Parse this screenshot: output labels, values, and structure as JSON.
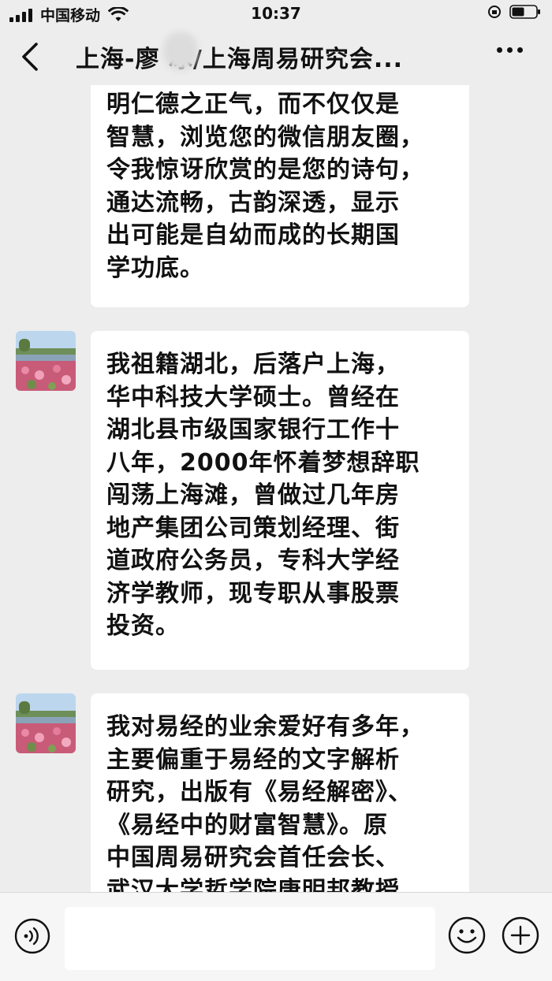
{
  "status_bar": {
    "carrier": "中国移动",
    "time": "10:37"
  },
  "header": {
    "title": "上海-廖  冰/上海周易研究会..."
  },
  "messages": [
    {
      "text": "明仁德之正气，而不仅仅是\n智慧，浏览您的微信朋友圈，\n令我惊讶欣赏的是您的诗句，\n通达流畅，古韵深透，显示\n出可能是自幼而成的长期国\n学功底。"
    },
    {
      "text": "我祖籍湖北，后落户上海，\n华中科技大学硕士。曾经在\n湖北县市级国家银行工作十\n八年，2000年怀着梦想辞职\n闯荡上海滩，曾做过几年房\n地产集团公司策划经理、街\n道政府公务员，专科大学经\n济学教师，现专职从事股票\n投资。"
    },
    {
      "text": "我对易经的业余爱好有多年，\n主要偏重于易经的文字解析\n研究，出版有《易经解密》、\n《易经中的财富智慧》。原\n中国周易研究会首任会长、\n武汉大学哲学院唐明邦教授"
    }
  ],
  "input": {
    "value": ""
  },
  "icons": {
    "back": "back-chevron-icon",
    "more": "more-dots-icon",
    "voice": "voice-icon",
    "emoji": "emoji-icon",
    "plus": "plus-icon"
  }
}
